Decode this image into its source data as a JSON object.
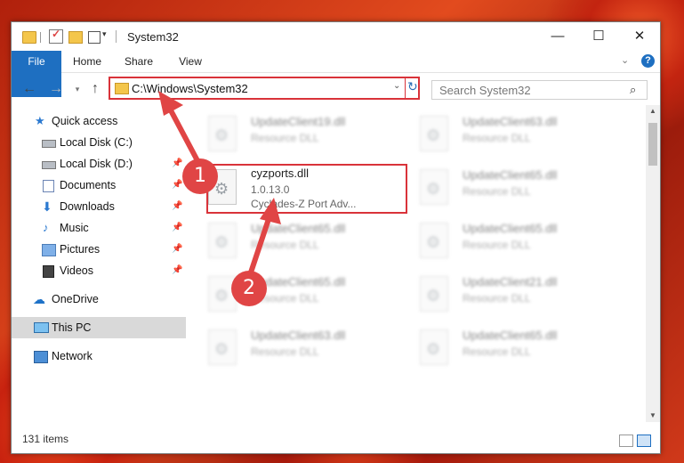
{
  "window": {
    "title": "System32",
    "controls": {
      "minimize": "—",
      "maximize": "☐",
      "close": "✕"
    }
  },
  "ribbon": {
    "tabs": [
      "File",
      "Home",
      "Share",
      "View"
    ],
    "help": "?"
  },
  "navigation": {
    "address": "C:\\Windows\\System32",
    "search_placeholder": "Search System32"
  },
  "sidebar": {
    "items": [
      {
        "label": "Quick access",
        "icon": "star-icon"
      },
      {
        "label": "Local Disk (C:)",
        "icon": "drive-icon"
      },
      {
        "label": "Local Disk (D:)",
        "icon": "drive-icon",
        "pinned": true
      },
      {
        "label": "Documents",
        "icon": "documents-icon",
        "pinned": true
      },
      {
        "label": "Downloads",
        "icon": "downloads-icon",
        "pinned": true
      },
      {
        "label": "Music",
        "icon": "music-icon",
        "pinned": true
      },
      {
        "label": "Pictures",
        "icon": "pictures-icon",
        "pinned": true
      },
      {
        "label": "Videos",
        "icon": "videos-icon",
        "pinned": true
      },
      {
        "label": "OneDrive",
        "icon": "cloud-icon"
      },
      {
        "label": "This PC",
        "icon": "computer-icon",
        "selected": true
      },
      {
        "label": "Network",
        "icon": "network-icon"
      }
    ]
  },
  "files": {
    "highlighted": {
      "name": "cyzports.dll",
      "version": "1.0.13.0",
      "description": "Cyclades-Z Port Adv..."
    },
    "left_column": [
      {
        "name": "UpdateClient19.dll",
        "type": "Resource DLL"
      },
      {
        "name": "UpdateClient65.dll",
        "type": "Resource DLL"
      },
      {
        "name": "UpdateClient65.dll",
        "type": "Resource DLL"
      },
      {
        "name": "UpdateClient63.dll",
        "type": "Resource DLL"
      }
    ],
    "right_column": [
      {
        "name": "UpdateClient63.dll",
        "type": "Resource DLL"
      },
      {
        "name": "UpdateClient65.dll",
        "type": "Resource DLL"
      },
      {
        "name": "UpdateClient65.dll",
        "type": "Resource DLL"
      },
      {
        "name": "UpdateClient21.dll",
        "type": "Resource DLL"
      },
      {
        "name": "UpdateClient65.dll",
        "type": "Resource DLL"
      }
    ]
  },
  "status": {
    "item_count": "131 items"
  },
  "annotations": {
    "step1": "1",
    "step2": "2",
    "color": "#e04545"
  }
}
